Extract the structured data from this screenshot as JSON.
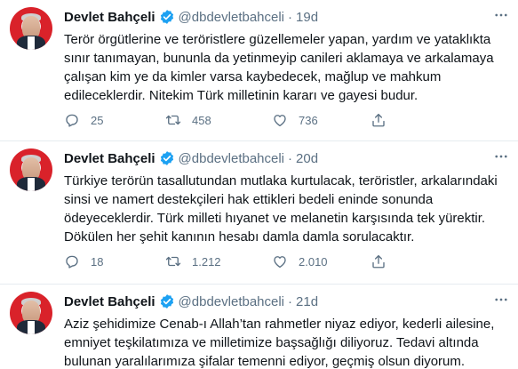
{
  "tweets": [
    {
      "name": "Devlet Bahçeli",
      "handle": "@dbdevletbahceli",
      "separator": "·",
      "time": "19d",
      "text": "Terör örgütlerine ve teröristlere güzellemeler yapan, yardım ve yataklıkta\nsınır tanımayan, bununla da yetinmeyip canileri aklamaya ve arkalamaya\nçalışan kim ye da kimler varsa kaybedecek, mağlup ve mahkum\nedileceklerdir. Nitekim Türk milletinin kararı ve gayesi budur.",
      "replies": "25",
      "retweets": "458",
      "likes": "736"
    },
    {
      "name": "Devlet Bahçeli",
      "handle": "@dbdevletbahceli",
      "separator": "·",
      "time": "20d",
      "text": "Türkiye terörün tasallutundan mutlaka kurtulacak, teröristler, arkalarındaki\nsinsi ve namert destekçileri hak ettikleri bedeli eninde sonunda\nödeyeceklerdir. Türk milleti hıyanet ve melanetin karşısında tek yürektir.\nDökülen her şehit kanının hesabı damla damla sorulacaktır.",
      "replies": "18",
      "retweets": "1.212",
      "likes": "2.010"
    },
    {
      "name": "Devlet Bahçeli",
      "handle": "@dbdevletbahceli",
      "separator": "·",
      "time": "21d",
      "text": "Aziz şehidimize Cenab-ı Allah’tan rahmetler niyaz ediyor, kederli ailesine,\nemniyet teşkilatımıza ve milletimize başsağlığı diliyoruz. Tedavi altında\nbulunan yaralılarımıza şifalar temenni ediyor, geçmiş olsun diyorum."
    }
  ],
  "icons": {
    "verified": "verified-badge-icon",
    "reply": "reply-icon",
    "retweet": "retweet-icon",
    "like": "heart-icon",
    "share": "share-icon",
    "more": "more-icon"
  },
  "colors": {
    "verified": "#1da1f2",
    "secondary_text": "#5b7083",
    "divider": "#e6ecf0"
  }
}
